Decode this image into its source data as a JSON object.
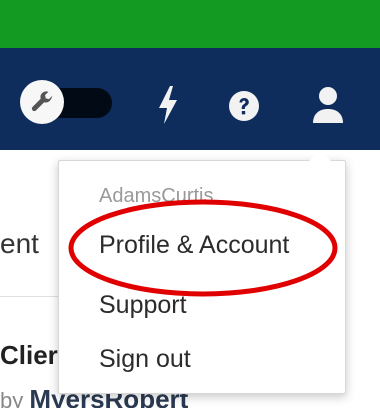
{
  "background": {
    "tab_partial_text": "ent",
    "row_title_partial": "Clier",
    "row_by_text": "by",
    "row_author_partial": "MyersRobert"
  },
  "dropdown": {
    "username": "AdamsCurtis",
    "items": [
      {
        "label": "Profile & Account"
      },
      {
        "label": "Support"
      },
      {
        "label": "Sign out"
      }
    ]
  },
  "colors": {
    "top_bar": "#139a23",
    "navbar": "#0e2c5c",
    "annotation": "#e00000"
  },
  "icons": [
    "wrench-icon",
    "lightning-icon",
    "help-icon",
    "user-icon"
  ]
}
